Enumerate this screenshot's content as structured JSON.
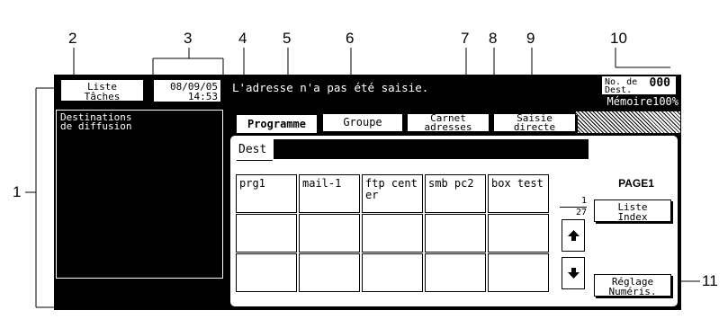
{
  "callouts": [
    "1",
    "2",
    "3",
    "4",
    "5",
    "6",
    "7",
    "8",
    "9",
    "10",
    "11"
  ],
  "header": {
    "job_list_button": [
      "Liste",
      "Tâches"
    ],
    "date": "08/09/05",
    "time": "14:53",
    "message": "L'adresse n'a pas été saisie.",
    "dest_count_label": [
      "No. de",
      "Dest."
    ],
    "dest_count_value": "000",
    "memory": "Mémoire100%"
  },
  "left_panel": {
    "title": [
      "Destinations",
      "de diffusion"
    ]
  },
  "tabs": [
    {
      "label": [
        "Programme"
      ],
      "active": true
    },
    {
      "label": [
        "Groupe"
      ],
      "active": false
    },
    {
      "label": [
        "Carnet",
        "adresses"
      ],
      "active": false
    },
    {
      "label": [
        "Saisie",
        "directe"
      ],
      "active": false
    }
  ],
  "dest_field": {
    "label": "Dest"
  },
  "grid": {
    "rows": [
      [
        "prg1",
        "mail-1",
        "ftp center",
        "smb pc2",
        "box test"
      ],
      [
        "",
        "",
        "",
        "",
        ""
      ],
      [
        "",
        "",
        "",
        "",
        ""
      ]
    ]
  },
  "pager": {
    "current": "1",
    "total": "27",
    "page_label": "PAGE1"
  },
  "index_button": [
    "Liste",
    "Index"
  ],
  "scan_settings_button": [
    "Réglage",
    "Numéris."
  ]
}
